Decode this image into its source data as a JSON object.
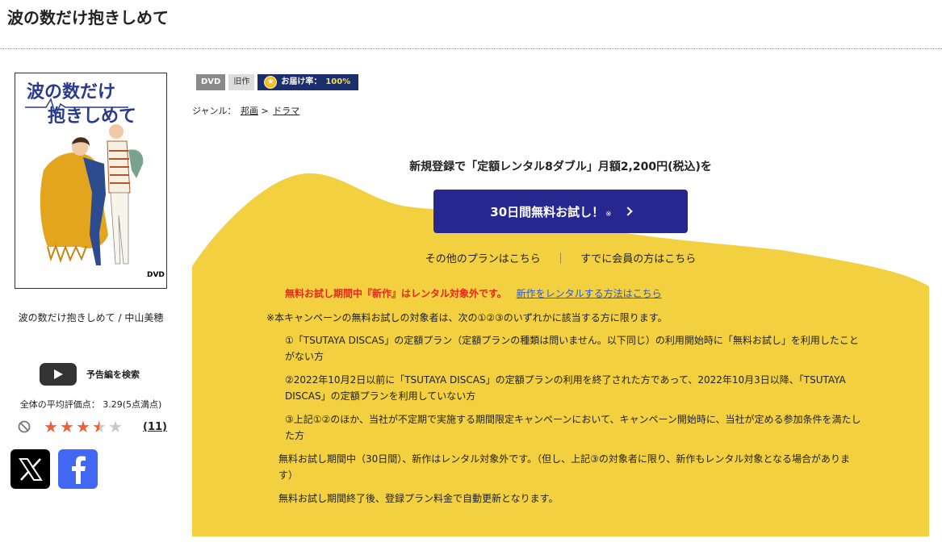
{
  "title": "波の数だけ抱きしめて",
  "jacket": {
    "title_line1": "波の数だけ",
    "title_line2": "抱きしめて",
    "logo": "DVD"
  },
  "product_name": "波の数だけ抱きしめて / 中山美穂",
  "trailer_label": "予告編を検索",
  "rating": {
    "text": "全体の平均評価点： 3.29(5点満点)",
    "stars": 3.29,
    "review_count": "(11)"
  },
  "share": {
    "x_icon": "x-logo-icon",
    "facebook_icon": "facebook-logo-icon"
  },
  "badges": {
    "dvd": "DVD",
    "old": "旧作",
    "delivery_label": "お届け率：",
    "delivery_rate": "100%"
  },
  "genre": {
    "label": "ジャンル：",
    "level1": "邦画",
    "arrow": ">",
    "level2": "ドラマ"
  },
  "promo": {
    "headline": "新規登録で「定額レンタル8ダブル」月額2,200円(税込)を",
    "cta_label": "30日間無料お試し！",
    "cta_mark": "※",
    "other_plans": "その他のプランはこちら",
    "separator": "｜",
    "member_link": "すでに会員の方はこちら",
    "warning": "無料お試し期間中『新作』はレンタル対象外です。",
    "warning_link": "新作をレンタルする方法はこちら",
    "notice": "※本キャンペーンの無料お試しの対象者は、次の①②③のいずれかに該当する方に限ります。",
    "condition1": "①「TSUTAYA DISCAS」の定額プラン（定額プランの種類は問いません。以下同じ）の利用開始時に「無料お試し」を利用したことがない方",
    "condition2": "②2022年10月2日以前に「TSUTAYA DISCAS」の定額プランの利用を終了された方であって、2022年10月3日以降、「TSUTAYA DISCAS」の定額プランを利用していない方",
    "condition3": "③上記①②のほか、当社が不定期で実施する期間限定キャンペーンにおいて、キャンペーン開始時に、当社が定める参加条件を満たした方",
    "note1": "無料お試し期間中（30日間）、新作はレンタル対象外です。（但し、上記③の対象者に限り、新作もレンタル対象となる場合があります）",
    "note2": "無料お試し期間終了後、登録プラン料金で自動更新となります。"
  },
  "colors": {
    "yellow": "#f2d03f",
    "navy": "#27278f",
    "warning_red": "#e8281d",
    "link_blue": "#2c58c8",
    "star_orange": "#e8613a"
  }
}
